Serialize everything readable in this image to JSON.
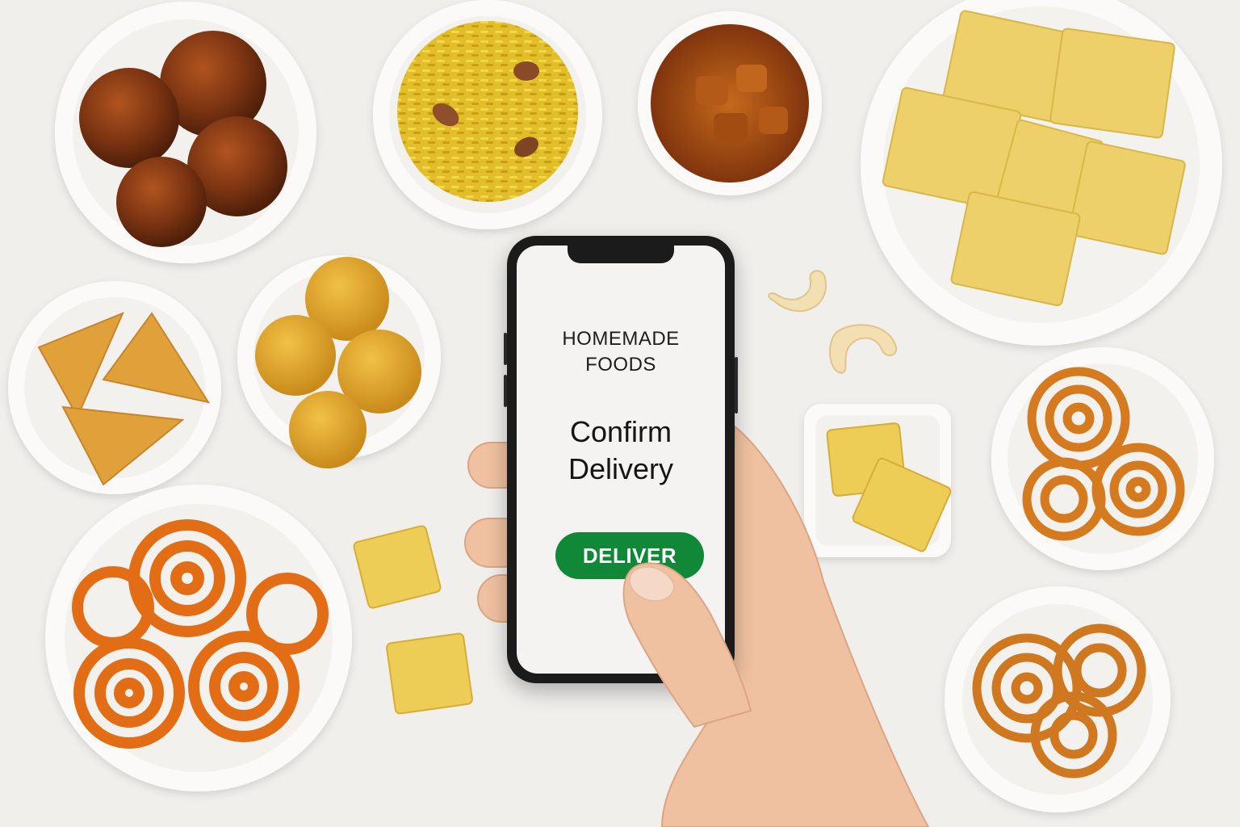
{
  "app": {
    "brand_line_1": "HOMEMADE",
    "brand_line_2": "FOODS",
    "heading_line_1": "Confirm",
    "heading_line_2": "Delivery",
    "deliver_label": "DELIVER"
  },
  "colors": {
    "background": "#f1efec",
    "deliver_button": "#108838",
    "phone_frame": "#1b1b1c",
    "screen": "#f4f3f1"
  },
  "icons": [
    "smartphone"
  ],
  "scene_items": [
    "gulab-jamun-bowl",
    "sev-mixture-bowl",
    "curry-bowl",
    "sweet-squares-plate",
    "cashews",
    "samosa-bowl",
    "ladoo-bowl",
    "jalebi-bowl",
    "chakli-bowl",
    "chakli-bowl-2",
    "mysore-pak-dish",
    "sweet-cubes"
  ]
}
